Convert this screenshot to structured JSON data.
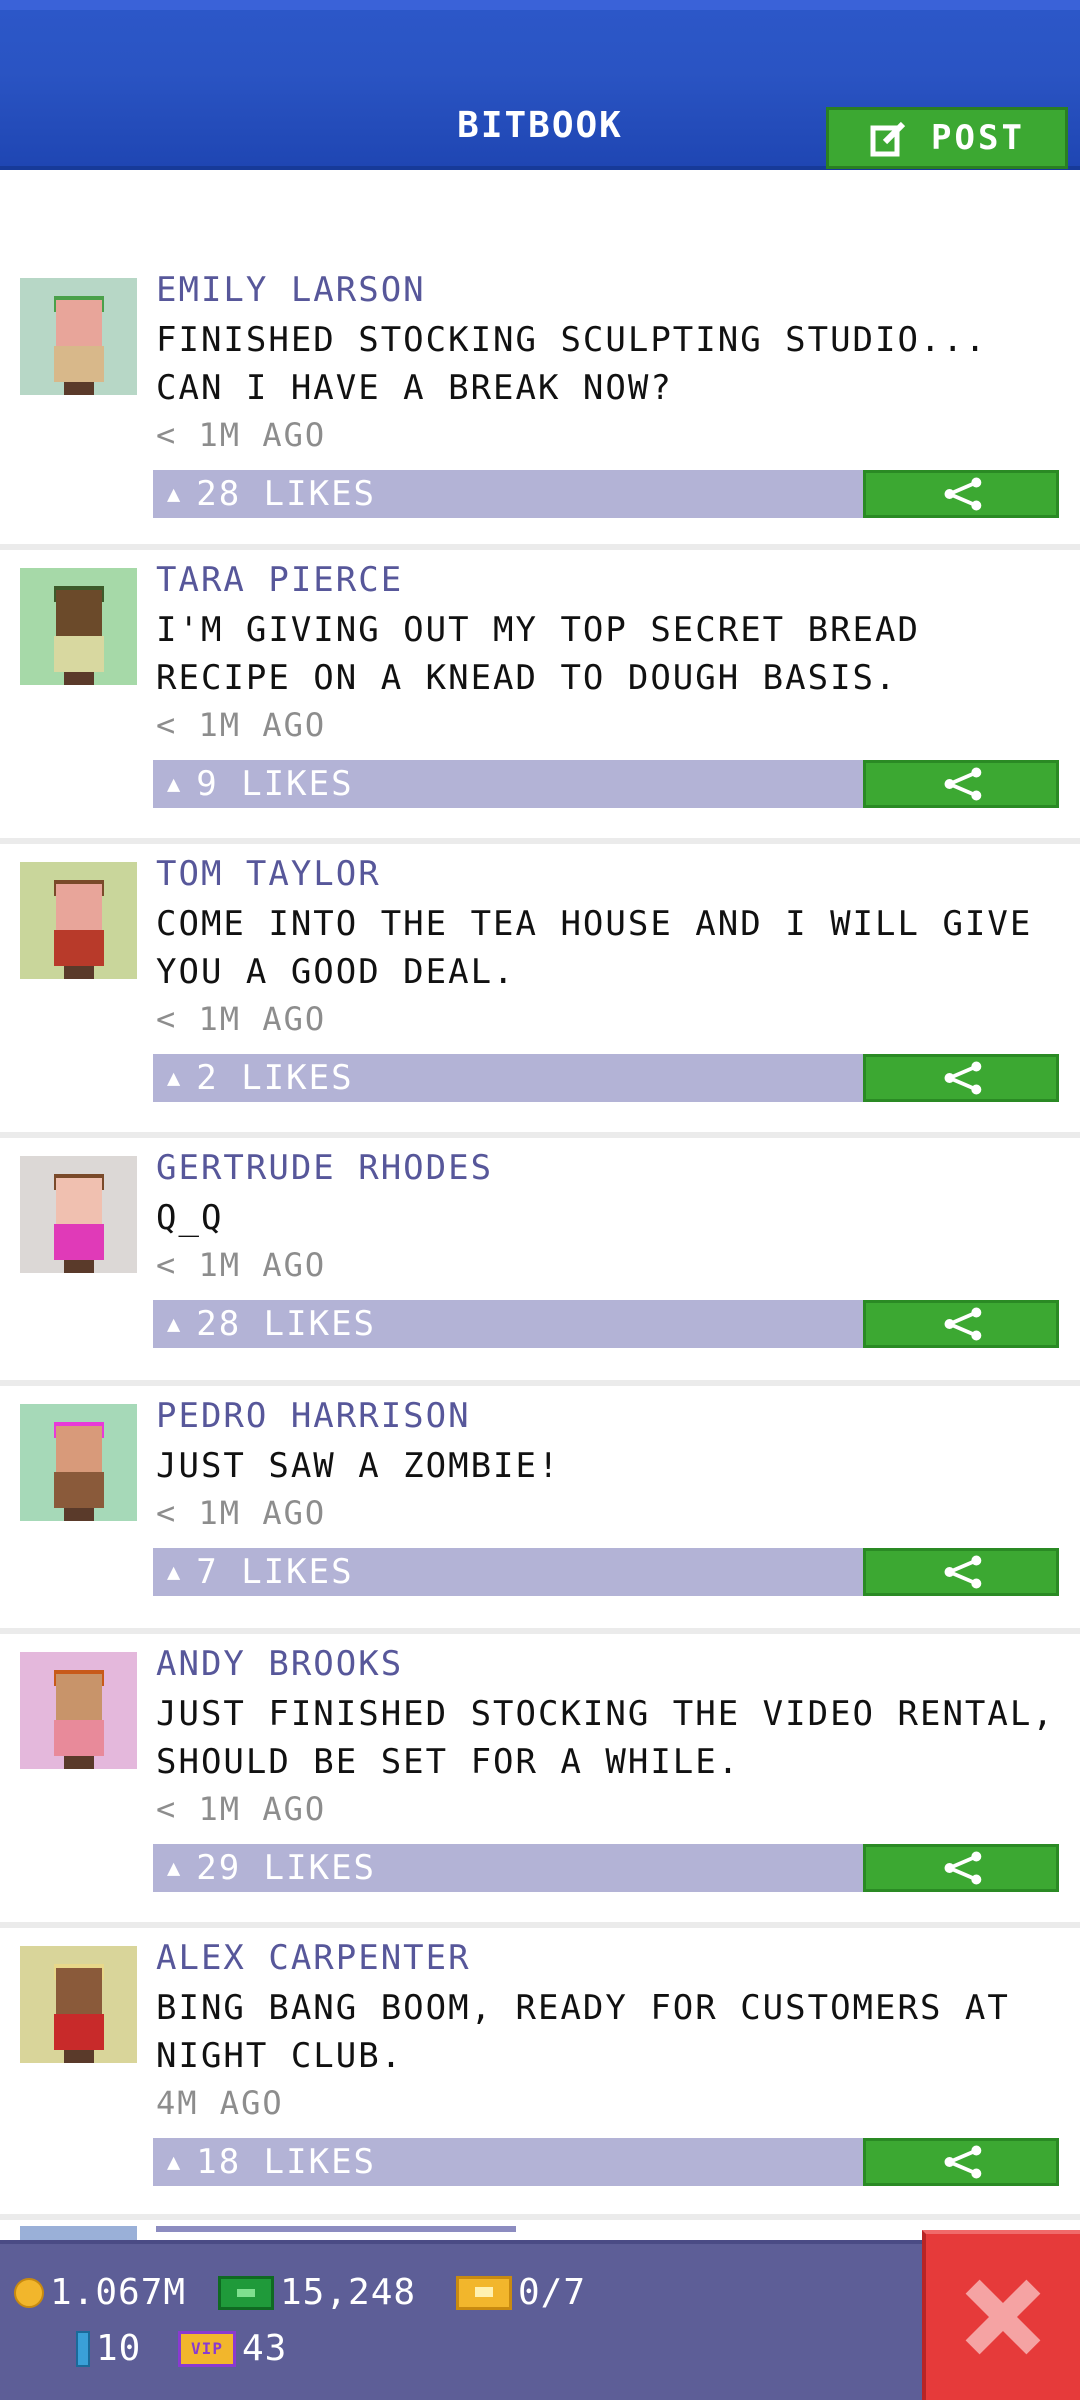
{
  "header": {
    "title": "BITBOOK",
    "post_label": "POST"
  },
  "posts": [
    {
      "name": "EMILY LARSON",
      "text": "FINISHED STOCKING SCULPTING STUDIO... CAN I HAVE A BREAK NOW?",
      "time": "< 1M AGO",
      "likes": "28 LIKES",
      "avatar_bg": "#b7d7c6",
      "skin": "#e8a59a",
      "hair": "#4aa04a",
      "shirt": "#d8b88a"
    },
    {
      "name": "TARA PIERCE",
      "text": "I'M GIVING OUT MY TOP SECRET BREAD RECIPE ON A KNEAD TO DOUGH BASIS.",
      "time": "< 1M AGO",
      "likes": "9 LIKES",
      "avatar_bg": "#a6d9a8",
      "skin": "#6b4a2a",
      "hair": "#3d5a2a",
      "shirt": "#d8d8a0"
    },
    {
      "name": "TOM TAYLOR",
      "text": "COME INTO THE TEA HOUSE AND I WILL GIVE YOU A GOOD DEAL.",
      "time": "< 1M AGO",
      "likes": "2 LIKES",
      "avatar_bg": "#c9d69b",
      "skin": "#e8a59a",
      "hair": "#7a4a2a",
      "shirt": "#b83a2a"
    },
    {
      "name": "GERTRUDE RHODES",
      "text": "Q_Q",
      "time": "< 1M AGO",
      "likes": "28 LIKES",
      "avatar_bg": "#dcd8d6",
      "skin": "#f0c0b0",
      "hair": "#7a4a2a",
      "shirt": "#e03ab8"
    },
    {
      "name": "PEDRO HARRISON",
      "text": "JUST SAW A ZOMBIE!",
      "time": "< 1M AGO",
      "likes": "7 LIKES",
      "avatar_bg": "#a6d9b8",
      "skin": "#d89a7a",
      "hair": "#e83ad8",
      "shirt": "#8a5a3a"
    },
    {
      "name": "ANDY BROOKS",
      "text": "JUST FINISHED STOCKING THE VIDEO RENTAL, SHOULD BE SET FOR A WHILE.",
      "time": "< 1M AGO",
      "likes": "29 LIKES",
      "avatar_bg": "#e4b8dc",
      "skin": "#c8946a",
      "hair": "#c85a1a",
      "shirt": "#e88a9a"
    },
    {
      "name": "ALEX CARPENTER",
      "text": "BING BANG BOOM, READY FOR CUSTOMERS AT NIGHT CLUB.",
      "time": "4M AGO",
      "likes": "18 LIKES",
      "avatar_bg": "#d9d59a",
      "skin": "#8a5a3a",
      "hair": "#e8d88a",
      "shirt": "#c82a2a"
    }
  ],
  "footer": {
    "coins": "1.067M",
    "cash": "15,248",
    "tickets": "0/7",
    "bux": "10",
    "vip": "43",
    "vip_label": "VIP"
  },
  "icons": {
    "post": "edit-icon",
    "share": "share-icon",
    "like": "thumb-up-icon",
    "close": "close-icon",
    "coin": "coin-icon",
    "cash": "cash-icon",
    "ticket": "ticket-icon",
    "bux": "bux-icon",
    "vip": "vip-icon"
  }
}
